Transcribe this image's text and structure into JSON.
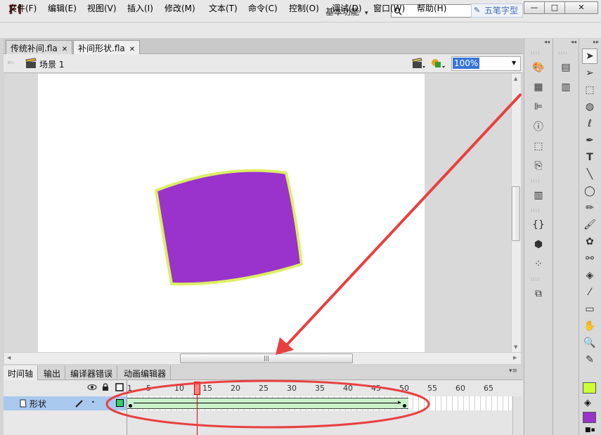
{
  "titlebar": {
    "logo": "Fl",
    "workspace": "基本功能",
    "search_placeholder": "",
    "watermark": "五笔字型",
    "minimize": "—",
    "maximize": "□",
    "close": "✕"
  },
  "menubar": [
    "文件(F)",
    "编辑(E)",
    "视图(V)",
    "插入(I)",
    "修改(M)",
    "文本(T)",
    "命令(C)",
    "控制(O)",
    "调试(D)",
    "窗口(W)",
    "帮助(H)"
  ],
  "doc_tabs": [
    {
      "label": "传统补间.fla",
      "close": "✕"
    },
    {
      "label": "补间形状.fla",
      "close": "✕"
    }
  ],
  "scene": {
    "label": "场景 1",
    "zoom": "100%"
  },
  "stage": {
    "shape_fill": "#9933cc",
    "shape_stroke": "#ddee66",
    "annotation_color": "#e84040"
  },
  "timeline": {
    "tabs": [
      "时间轴",
      "输出",
      "编译器错误",
      "动画编辑器"
    ],
    "frame_numbers": [
      "1",
      "5",
      "10",
      "15",
      "20",
      "25",
      "30",
      "35",
      "40",
      "45",
      "50",
      "55",
      "60",
      "65"
    ],
    "current_frame": 13,
    "tween_start": 1,
    "tween_end": 50,
    "layer": {
      "name": "形状",
      "color": "#33cc66"
    }
  },
  "colors": {
    "stroke": "#ccff33",
    "fill": "#9933cc"
  }
}
